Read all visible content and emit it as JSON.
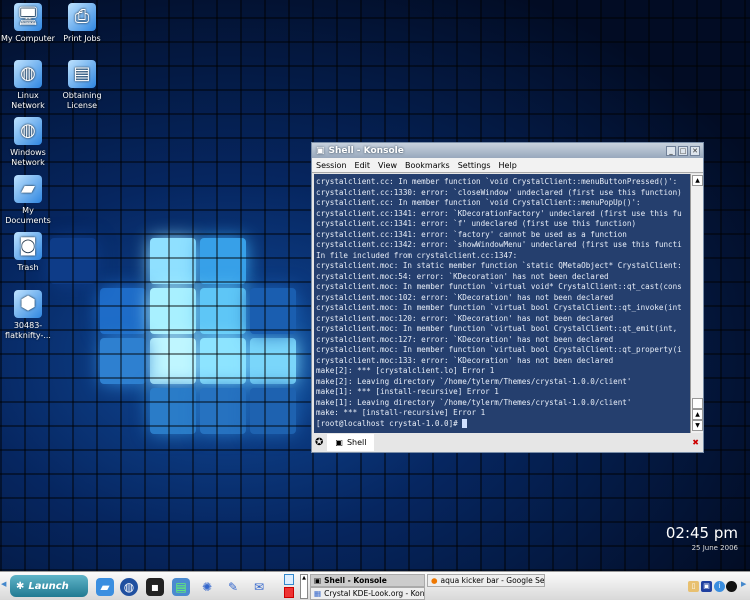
{
  "desktop": {
    "icons": [
      {
        "label": "My Computer",
        "icon": "computer-icon"
      },
      {
        "label": "Print Jobs",
        "icon": "printer-icon"
      },
      {
        "label": "Linux Network",
        "icon": "network-icon"
      },
      {
        "label": "Obtaining License",
        "icon": "document-icon"
      },
      {
        "label": "Windows Network",
        "icon": "network-icon"
      },
      {
        "label": "My Documents",
        "icon": "folder-icon"
      },
      {
        "label": "Trash",
        "icon": "trash-icon"
      },
      {
        "label": "30483-flatknifty-...",
        "icon": "package-icon"
      }
    ]
  },
  "konsole": {
    "title": "Shell - Konsole",
    "menu": [
      "Session",
      "Edit",
      "View",
      "Bookmarks",
      "Settings",
      "Help"
    ],
    "lines": [
      "crystalclient.cc: In member function `void CrystalClient::menuButtonPressed()':",
      "crystalclient.cc:1330: error: `closeWindow' undeclared (first use this function)",
      "crystalclient.cc: In member function `void CrystalClient::menuPopUp()':",
      "crystalclient.cc:1341: error: `KDecorationFactory' undeclared (first use this fu",
      "crystalclient.cc:1341: error: `f' undeclared (first use this function)",
      "crystalclient.cc:1341: error: `factory' cannot be used as a function",
      "crystalclient.cc:1342: error: `showWindowMenu' undeclared (first use this functi",
      "In file included from crystalclient.cc:1347:",
      "crystalclient.moc: In static member function `static QMetaObject* CrystalClient:",
      "crystalclient.moc:54: error: `KDecoration' has not been declared",
      "crystalclient.moc: In member function `virtual void* CrystalClient::qt_cast(cons",
      "crystalclient.moc:102: error: `KDecoration' has not been declared",
      "crystalclient.moc: In member function `virtual bool CrystalClient::qt_invoke(int",
      "crystalclient.moc:120: error: `KDecoration' has not been declared",
      "crystalclient.moc: In member function `virtual bool CrystalClient::qt_emit(int,",
      "crystalclient.moc:127: error: `KDecoration' has not been declared",
      "crystalclient.moc: In member function `virtual bool CrystalClient::qt_property(i",
      "crystalclient.moc:133: error: `KDecoration' has not been declared",
      "make[2]: *** [crystalclient.lo] Error 1",
      "make[2]: Leaving directory `/home/tylerm/Themes/crystal-1.0.0/client'",
      "make[1]: *** [install-recursive] Error 1",
      "make[1]: Leaving directory `/home/tylerm/Themes/crystal-1.0.0/client'",
      "make: *** [install-recursive] Error 1"
    ],
    "prompt": "[root@localhost crystal-1.0.0]# ",
    "tab": "Shell"
  },
  "clock": {
    "time": "02:45 pm",
    "date": "25 June 2006"
  },
  "taskbar": {
    "launch": "Launch",
    "tasks": [
      "Shell - Konsole",
      "Crystal KDE-Look.org - Konq",
      "aqua kicker bar - Google Se"
    ]
  }
}
